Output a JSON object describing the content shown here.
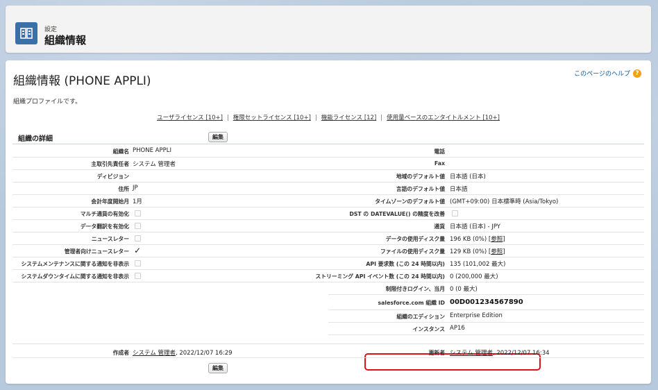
{
  "header": {
    "eyebrow": "設定",
    "title": "組織情報",
    "icon": "building-icon"
  },
  "page": {
    "title": "組織情報 (PHONE APPLI)",
    "help_link": "このページのヘルプ",
    "help_icon": "?",
    "description": "組織プロファイルです。"
  },
  "links": [
    "ユーザライセンス [10+]",
    "権限セットライセンス [10+]",
    "機能ライセンス [12]",
    "使用量ベースのエンタイトルメント [10+]"
  ],
  "section": {
    "title": "組織の詳細",
    "edit_label": "編集"
  },
  "left_rows": [
    {
      "label": "組織名",
      "value": "PHONE APPLI"
    },
    {
      "label": "主取引先責任者",
      "value": "システム 管理者"
    },
    {
      "label": "ディビジョン",
      "value": ""
    },
    {
      "label": "住所",
      "value": "JP"
    },
    {
      "label": "会計年度開始月",
      "value": "1月"
    },
    {
      "label": "マルチ通貨の有効化",
      "value": ""
    },
    {
      "label": "データ翻訳を有効化",
      "value": ""
    },
    {
      "label": "ニュースレター",
      "value": ""
    },
    {
      "label": "管理者向けニュースレター",
      "value": "✓"
    },
    {
      "label": "システムメンテナンスに関する通知を非表示",
      "value": ""
    },
    {
      "label": "システムダウンタイムに関する通知を非表示",
      "value": ""
    }
  ],
  "right_rows": [
    {
      "label": "電話",
      "value": ""
    },
    {
      "label": "Fax",
      "value": ""
    },
    {
      "label": "地域のデフォルト値",
      "value": "日本語 (日本)"
    },
    {
      "label": "言語のデフォルト値",
      "value": "日本語"
    },
    {
      "label": "タイムゾーンのデフォルト値",
      "value": "(GMT+09:00) 日本標準時 (Asia/Tokyo)"
    },
    {
      "label": "DST の DATEVALUE() の精度を改善",
      "value": ""
    },
    {
      "label": "通貨",
      "value": "日本語 (日本) - JPY"
    },
    {
      "label": "データの使用ディスク量",
      "value": "196 KB (0%)",
      "link": "参照"
    },
    {
      "label": "ファイルの使用ディスク量",
      "value": "129 KB (0%)",
      "link": "参照"
    },
    {
      "label": "API 要求数 (この 24 時間以内)",
      "value": "135 (101,002 最大)"
    },
    {
      "label": "ストリーミング API イベント数 (この 24 時間以内)",
      "value": "0 (200,000 最大)"
    },
    {
      "label": "制限付きログイン、当月",
      "value": "0 (0 最大)"
    },
    {
      "label": "salesforce.com 組織 ID",
      "value": "00D001234567890"
    },
    {
      "label": "組織のエディション",
      "value": "Enterprise Edition"
    },
    {
      "label": "インスタンス",
      "value": "AP16"
    }
  ],
  "footer": {
    "created_label": "作成者",
    "created_user": "システム 管理者",
    "created_date": ", 2022/12/07 16:29",
    "updated_label": "更新者",
    "updated_user": "システム 管理者",
    "updated_date": ", 2022/12/07 16:34"
  },
  "colors": {
    "highlight": "#e0101b",
    "icon_bg": "#3b6fa8",
    "help_badge": "#f2a20a"
  }
}
